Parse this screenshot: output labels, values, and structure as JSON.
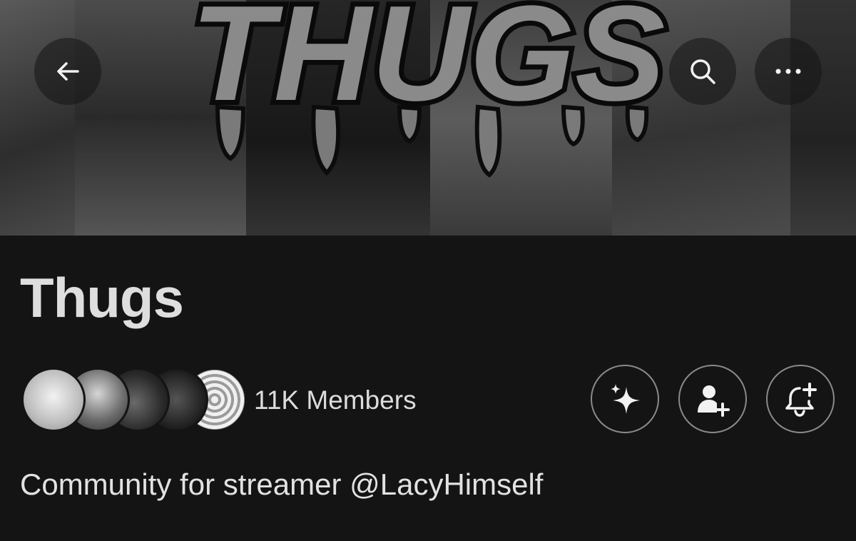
{
  "banner": {
    "logo_text": "THUGS"
  },
  "topbar": {
    "back_icon": "arrow-left-icon",
    "search_icon": "search-icon",
    "more_icon": "more-horizontal-icon"
  },
  "community": {
    "name": "Thugs",
    "members_label": "11K Members",
    "description": "Community for streamer @LacyHimself"
  },
  "actions": {
    "grok_icon": "sparkle-icon",
    "join_icon": "person-add-icon",
    "notify_icon": "bell-add-icon"
  },
  "colors": {
    "background": "#141414",
    "text": "#e7e7e7",
    "button_border": "#8a8a8a"
  }
}
